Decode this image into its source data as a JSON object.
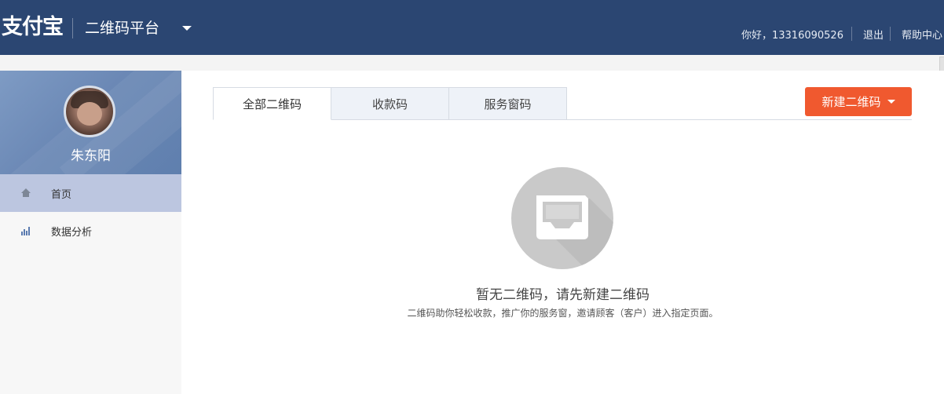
{
  "header": {
    "logo": "支付宝",
    "platform": "二维码平台",
    "greeting": "你好，13316090526",
    "logout": "退出",
    "help": "帮助中心"
  },
  "sidebar": {
    "username": "朱东阳",
    "items": [
      {
        "label": "首页",
        "icon": "home-icon",
        "active": true
      },
      {
        "label": "数据分析",
        "icon": "bar-chart-icon",
        "active": false
      }
    ]
  },
  "main": {
    "tabs": [
      {
        "label": "全部二维码",
        "active": true
      },
      {
        "label": "收款码",
        "active": false
      },
      {
        "label": "服务窗码",
        "active": false
      }
    ],
    "new_button": "新建二维码",
    "empty_icon": "inbox-tray-icon",
    "empty_title": "暂无二维码，请先新建二维码",
    "empty_desc": "二维码助你轻松收款，推广你的服务窗，邀请顾客（客户）进入指定页面。"
  },
  "colors": {
    "header_bg": "#2b4672",
    "sidebar_active": "#bcc6e0",
    "accent_button": "#f0592f",
    "empty_icon_bg": "#c9c9c9"
  }
}
